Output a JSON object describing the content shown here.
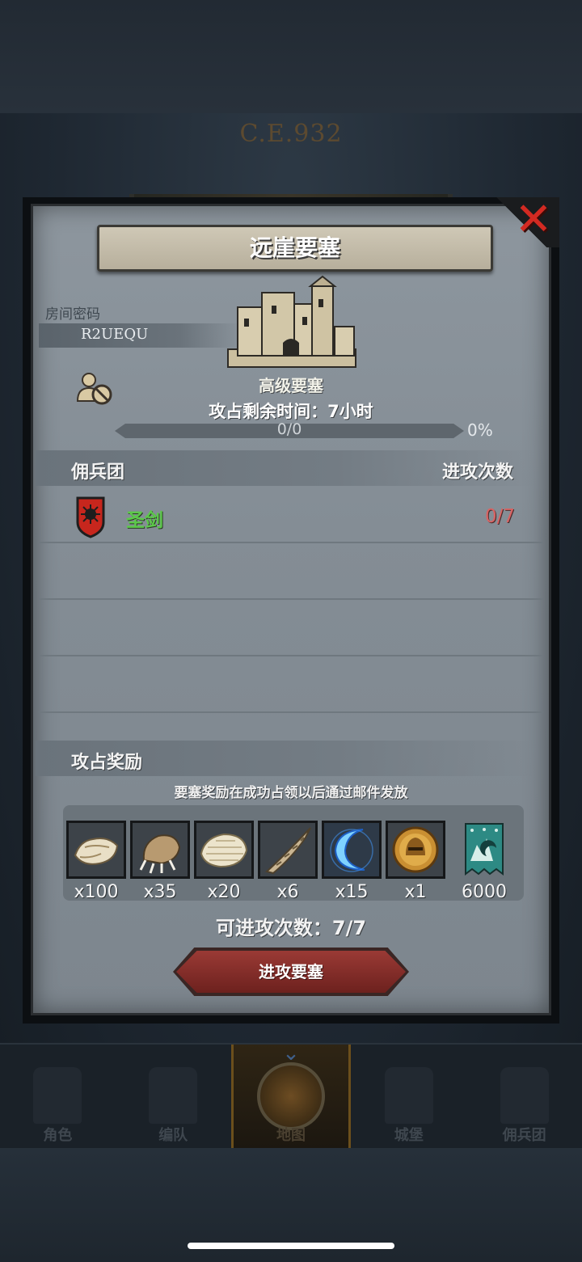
{
  "background": {
    "era": "C.E.932"
  },
  "dialog": {
    "title": "远崖要塞",
    "room": {
      "label": "房间密码",
      "code": "R2UEQU"
    },
    "fortress": {
      "type": "高级要塞",
      "time_left": "攻占剩余时间：7小时"
    },
    "progress": {
      "text": "0/0",
      "percent_label": "0%",
      "value": 0
    },
    "mercenary_section": {
      "title": "佣兵团",
      "attacks_header": "进攻次数",
      "rows": [
        {
          "name": "圣剑",
          "attacks": "0/7",
          "empty_rows_after": 3
        }
      ]
    },
    "rewards": {
      "title": "攻占奖励",
      "note": "要塞奖励在成功占领以后通过邮件发放",
      "items": [
        {
          "icon": "fur-pelt-icon",
          "qty": "x100"
        },
        {
          "icon": "beast-claw-icon",
          "qty": "x35"
        },
        {
          "icon": "scale-hide-icon",
          "qty": "x20"
        },
        {
          "icon": "twisted-horn-icon",
          "qty": "x6"
        },
        {
          "icon": "blue-crescent-icon",
          "qty": "x15"
        },
        {
          "icon": "golden-helmet-coin-icon",
          "qty": "x1"
        },
        {
          "icon": "guild-banner-icon",
          "qty": "6000"
        }
      ]
    },
    "attacks_left": "可进攻次数：7/7",
    "attack_button": "进攻要塞"
  },
  "nav": {
    "items": [
      {
        "label": "角色",
        "active": false
      },
      {
        "label": "编队",
        "active": false
      },
      {
        "label": "地图",
        "active": true
      },
      {
        "label": "城堡",
        "active": false
      },
      {
        "label": "佣兵团",
        "active": false
      }
    ]
  },
  "colors": {
    "accent_red": "#d22a22",
    "merc_name_green": "#5cc84a",
    "attack_count_red": "#d86464",
    "button_red": "#9a3a35"
  }
}
